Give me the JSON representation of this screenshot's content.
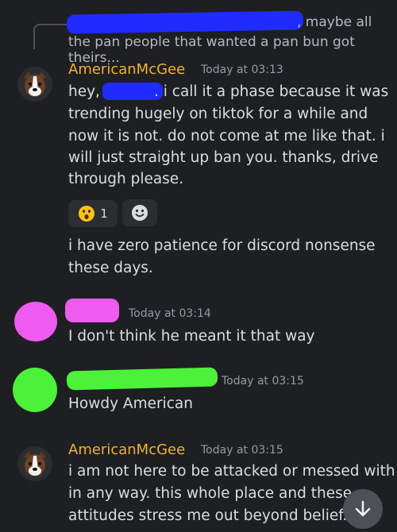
{
  "reply": {
    "preview_line1": ", maybe all",
    "preview_line2": "the pan people that wanted a pan bun got theirs..."
  },
  "messages": [
    {
      "username": "AmericanMcGee",
      "timestamp": "Today at 03:13",
      "text_a1": "hey,",
      "text_a2": ". i call it a phase because it was",
      "lines": [
        "trending hugely on tiktok for a while and",
        "now it is not. do not come at me like that. i",
        "will just straight up ban you. thanks, drive",
        "through please."
      ],
      "reactions": [
        {
          "emoji": "astonished-face-icon",
          "count": "1"
        }
      ],
      "followup": [
        "i have zero patience for discord nonsense",
        "these days."
      ]
    },
    {
      "timestamp": "Today at 03:14",
      "text": "I don't think he meant it that way"
    },
    {
      "timestamp": "Today at 03:15",
      "text": "Howdy American"
    },
    {
      "username": "AmericanMcGee",
      "timestamp": "Today at 03:15",
      "lines": [
        "i am not here to be attacked or messed with",
        "in any way. this whole place and these",
        "attitudes stress me out beyond belief."
      ]
    }
  ],
  "colors": {
    "background": "#1e1f22",
    "username": "#f0b232",
    "redaction_blue": "#1f2bff",
    "redaction_pink": "#ee5bf0",
    "redaction_green": "#4cf23a"
  }
}
